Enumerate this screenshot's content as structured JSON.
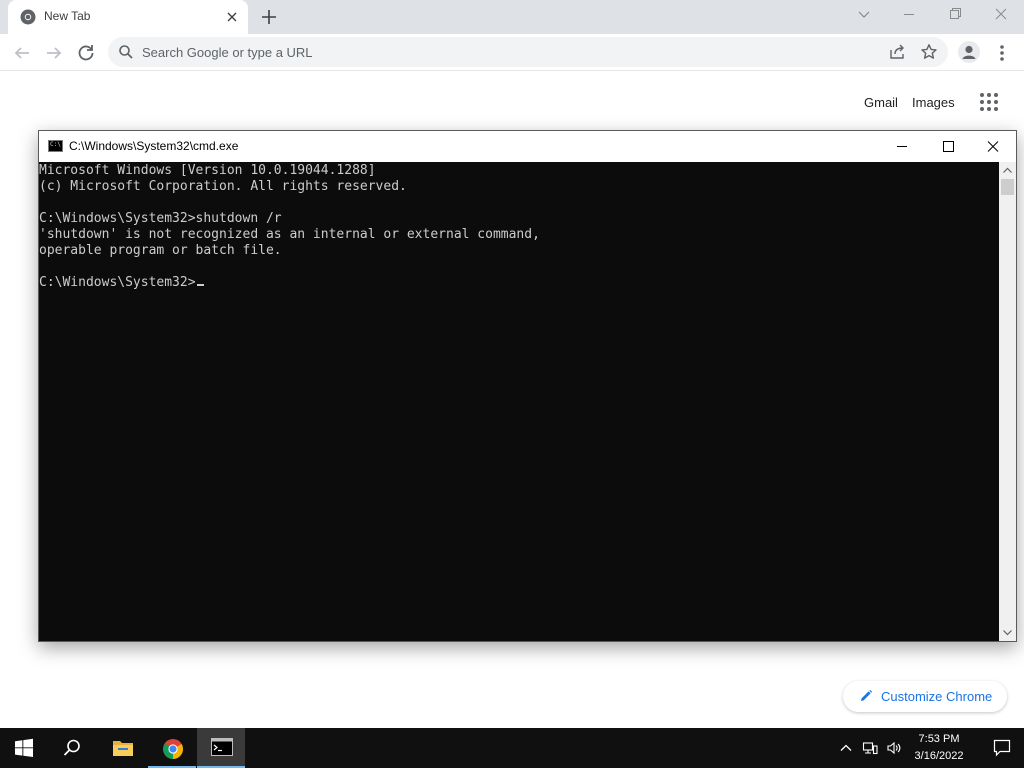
{
  "browser": {
    "tab": {
      "title": "New Tab"
    },
    "omnibox": {
      "placeholder": "Search Google or type a URL"
    },
    "ntp": {
      "gmail_label": "Gmail",
      "images_label": "Images",
      "customize_label": "Customize Chrome"
    }
  },
  "cmd": {
    "title": "C:\\Windows\\System32\\cmd.exe",
    "icon_text": "C:\\",
    "lines": [
      "Microsoft Windows [Version 10.0.19044.1288]",
      "(c) Microsoft Corporation. All rights reserved.",
      "",
      "C:\\Windows\\System32>shutdown /r",
      "'shutdown' is not recognized as an internal or external command,",
      "operable program or batch file.",
      "",
      "C:\\Windows\\System32>"
    ]
  },
  "taskbar": {
    "clock_time": "7:53 PM",
    "clock_date": "3/16/2022",
    "icons": [
      "windows-start-icon",
      "search-icon",
      "file-explorer-icon",
      "chrome-icon",
      "cmd-icon"
    ],
    "tray_icons": [
      "chevron-up-icon",
      "network-icon",
      "volume-icon",
      "notification-icon"
    ]
  },
  "colors": {
    "console_bg": "#0c0c0c",
    "console_text": "#cccccc",
    "accent_blue": "#1a73e8",
    "taskbar_bg": "#101010"
  }
}
